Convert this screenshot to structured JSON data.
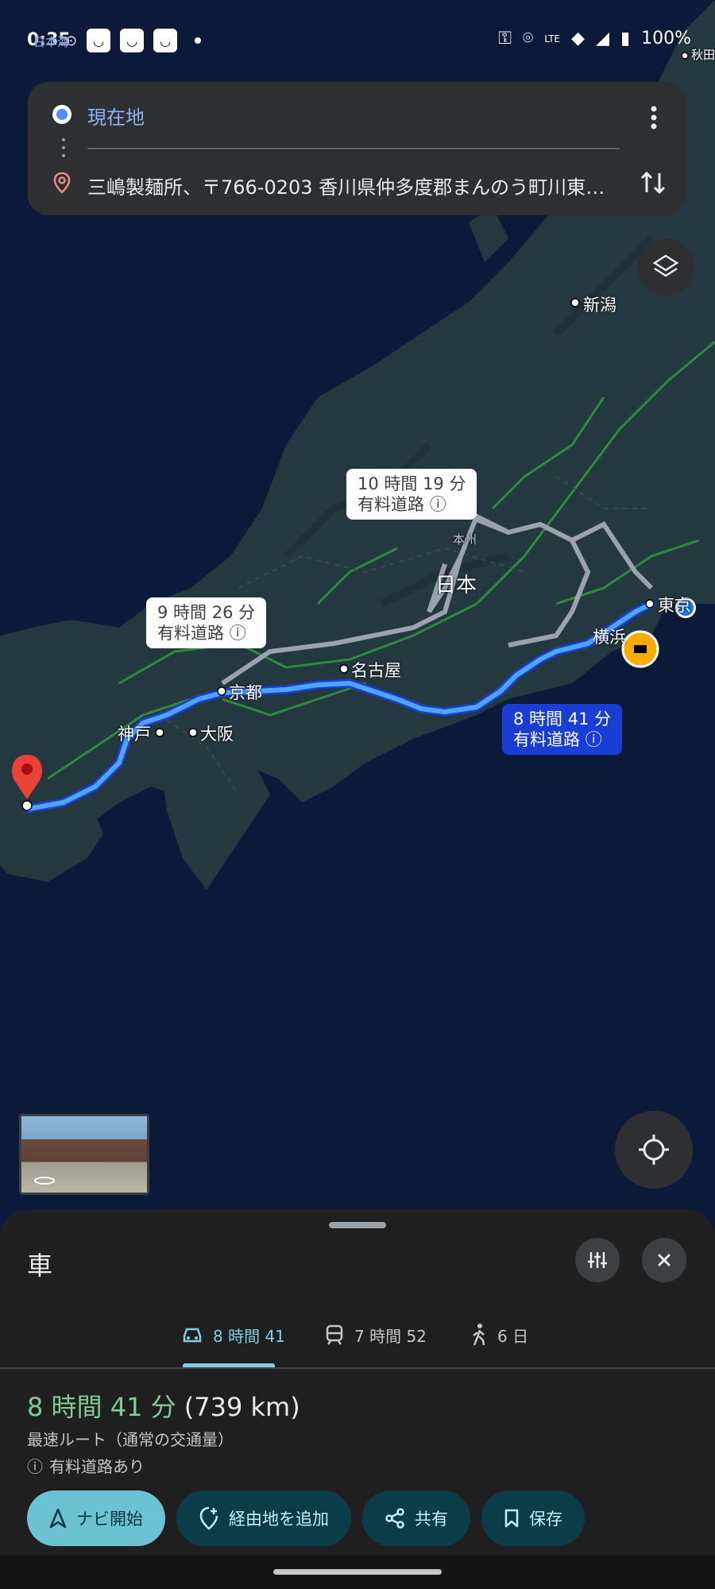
{
  "status_bar": {
    "time": "0:35",
    "battery": "100%",
    "notif_icons": [
      "vpn-icon",
      "shop-icon",
      "shop-icon",
      "shop-icon"
    ],
    "network_label": "LTE"
  },
  "directions": {
    "origin": "現在地",
    "destination": "三嶋製麺所、〒766-0203 香川県仲多度郡まんのう町川東２..."
  },
  "map": {
    "places": {
      "niigata": "新潟",
      "akita": "秋田",
      "nihon": "日本",
      "honshu": "本州",
      "nagoya": "名古屋",
      "kyoto": "京都",
      "kobe": "神戸",
      "osaka": "大阪",
      "yokohama": "横浜",
      "tokyo": "東京",
      "sea": "日本海"
    },
    "routes": [
      {
        "time": "10 時間 19 分",
        "note": "有料道路"
      },
      {
        "time": "9 時間 26 分",
        "note": "有料道路"
      },
      {
        "time": "8 時間 41 分",
        "note": "有料道路"
      }
    ]
  },
  "sheet": {
    "mode_title": "車",
    "tabs": [
      {
        "label": "8 時間 41",
        "icon": "car-icon",
        "active": true
      },
      {
        "label": "7 時間 52",
        "icon": "train-icon",
        "active": false
      },
      {
        "label": "6 日",
        "icon": "walk-icon",
        "active": false
      }
    ],
    "summary_duration": "8 時間 41 分",
    "summary_distance": "(739 km)",
    "route_description": "最速ルート（通常の交通量）",
    "toll_note": "有料道路あり",
    "actions": {
      "start": "ナビ開始",
      "add_stop": "経由地を追加",
      "share": "共有",
      "save": "保存"
    }
  },
  "colors": {
    "accent": "#6ac2d3",
    "route_active": "#1a73e8",
    "duration_green": "#81c995",
    "destination_pin": "#ea4335"
  }
}
